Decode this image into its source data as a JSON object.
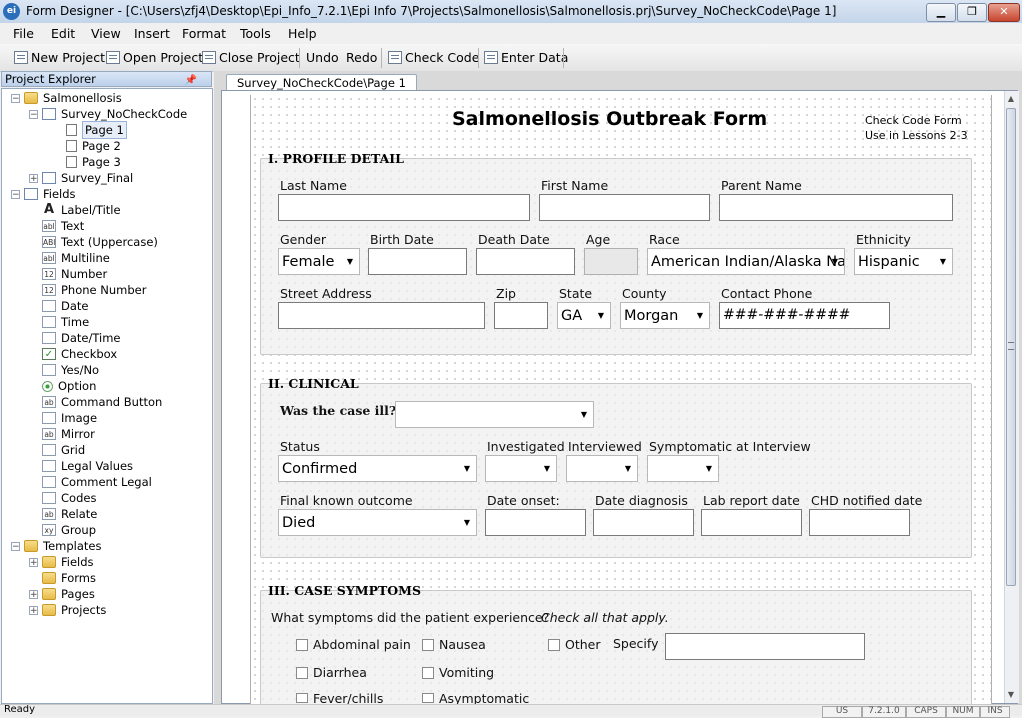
{
  "window": {
    "title": "Form Designer - [C:\\Users\\zfj4\\Desktop\\Epi_Info_7.2.1\\Epi Info 7\\Projects\\Salmonellosis\\Salmonellosis.prj\\Survey_NoCheckCode\\Page 1]",
    "app_icon": "ei"
  },
  "menu": [
    "File",
    "Edit",
    "View",
    "Insert",
    "Format",
    "Tools",
    "Help"
  ],
  "toolbar": {
    "new_project": "New Project",
    "open_project": "Open Project",
    "close_project": "Close Project",
    "undo": "Undo",
    "redo": "Redo",
    "check_code": "Check Code",
    "enter_data": "Enter Data"
  },
  "explorer": {
    "title": "Project Explorer",
    "project": "Salmonellosis",
    "form1": "Survey_NoCheckCode",
    "pages": [
      "Page 1",
      "Page 2",
      "Page 3"
    ],
    "form2": "Survey_Final",
    "fields_label": "Fields",
    "fields": [
      "Label/Title",
      "Text",
      "Text (Uppercase)",
      "Multiline",
      "Number",
      "Phone Number",
      "Date",
      "Time",
      "Date/Time",
      "Checkbox",
      "Yes/No",
      "Option",
      "Command Button",
      "Image",
      "Mirror",
      "Grid",
      "Legal Values",
      "Comment Legal",
      "Codes",
      "Relate",
      "Group"
    ],
    "field_icons": [
      "A",
      "abl",
      "ABl",
      "abl",
      "12",
      "12",
      "",
      "",
      "",
      "✓",
      "",
      "",
      "ab",
      "",
      "ab",
      "",
      "",
      "",
      "",
      "ab",
      "xy"
    ],
    "templates_label": "Templates",
    "templates": [
      "Fields",
      "Forms",
      "Pages",
      "Projects"
    ]
  },
  "doc_tab": "Survey_NoCheckCode\\Page 1",
  "form": {
    "title": "Salmonellosis Outbreak Form",
    "note_line1": "Check Code Form",
    "note_line2": "Use in Lessons 2-3",
    "s1": {
      "heading": "I. PROFILE DETAIL",
      "last_name": "Last Name",
      "first_name": "First Name",
      "parent_name": "Parent Name",
      "gender": "Gender",
      "gender_value": "Female",
      "birth_date": "Birth Date",
      "death_date": "Death Date",
      "age": "Age",
      "race": "Race",
      "race_value": "American Indian/Alaska Na",
      "ethnicity": "Ethnicity",
      "ethnicity_value": "Hispanic",
      "street": "Street Address",
      "zip": "Zip",
      "state": "State",
      "state_value": "GA",
      "county": "County",
      "county_value": "Morgan",
      "phone": "Contact Phone",
      "phone_value": "###-###-####"
    },
    "s2": {
      "heading": "II. CLINICAL",
      "was_ill": "Was the case ill?",
      "status": "Status",
      "status_value": "Confirmed",
      "investigated": "Investigated",
      "interviewed": "Interviewed",
      "symptomatic": "Symptomatic at Interview",
      "outcome": "Final known outcome",
      "outcome_value": "Died",
      "date_onset": "Date onset:",
      "date_diagnosis": "Date diagnosis",
      "lab_report_date": "Lab report date",
      "chd_notified": "CHD notified date"
    },
    "s3": {
      "heading": "III. CASE SYMPTOMS",
      "question": "What symptoms did the patient experience?",
      "hint": "Check all that apply.",
      "abdominal": "Abdominal pain",
      "nausea": "Nausea",
      "other": "Other",
      "specify": "Specify",
      "diarrhea": "Diarrhea",
      "vomiting": "Vomiting",
      "fever": "Fever/chills",
      "asymptomatic": "Asymptomatic"
    }
  },
  "status": {
    "text": "Ready",
    "panels": [
      "US",
      "7.2.1.0",
      "CAPS",
      "NUM",
      "INS"
    ]
  }
}
